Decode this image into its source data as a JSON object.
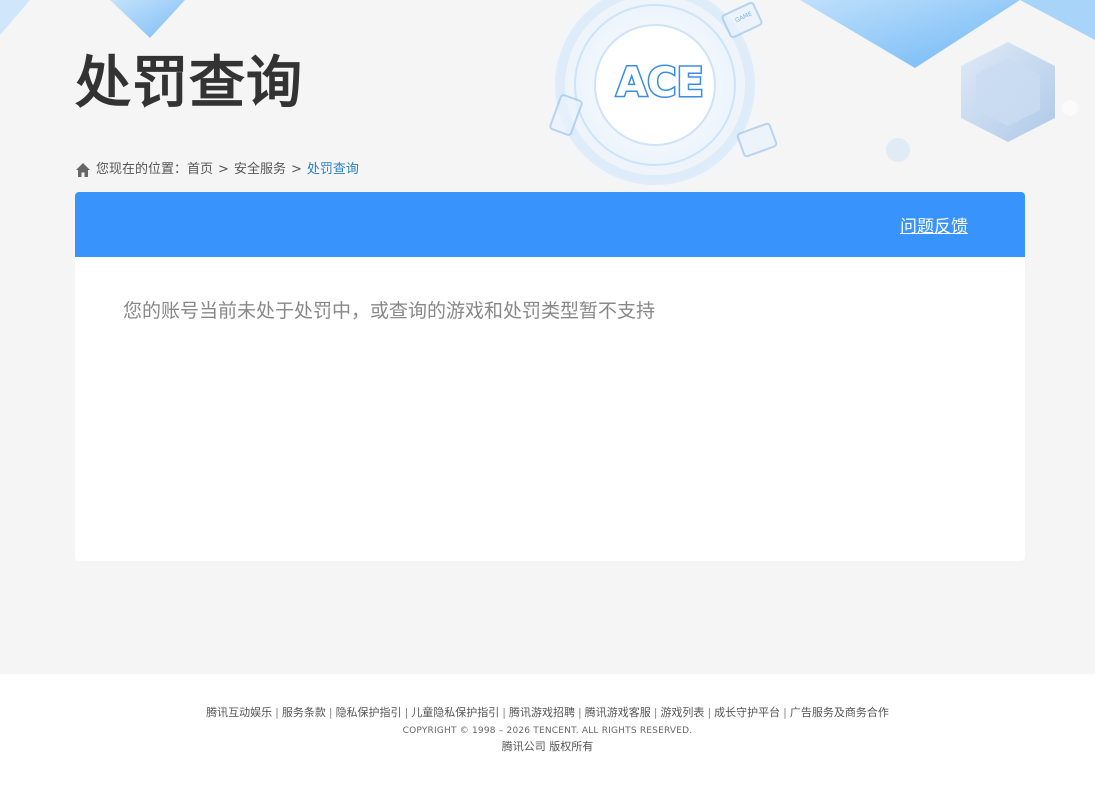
{
  "header": {
    "title": "处罚查询"
  },
  "breadcrumb": {
    "prefix": "您现在的位置：",
    "items": [
      "首页",
      "安全服务"
    ],
    "separator": ">",
    "current": "处罚查询"
  },
  "panel": {
    "feedback_link": "问题反馈",
    "result_message": "您的账号当前未处于处罚中，或查询的游戏和处罚类型暂不支持"
  },
  "decor": {
    "logo_text": "ACE",
    "game_badge": "GAME"
  },
  "footer": {
    "links": [
      "腾讯互动娱乐",
      "服务条款",
      "隐私保护指引",
      "儿童隐私保护指引",
      "腾讯游戏招聘",
      "腾讯游戏客服",
      "游戏列表",
      "成长守护平台",
      "广告服务及商务合作"
    ],
    "separator": "|",
    "copyright": "COPYRIGHT © 1998 – 2026 TENCENT. ALL RIGHTS RESERVED.",
    "rights": "腾讯公司 版权所有"
  },
  "colors": {
    "accent": "#3894fc",
    "breadcrumb_current": "#2d7fc1",
    "title": "#333333",
    "message": "#888888"
  }
}
